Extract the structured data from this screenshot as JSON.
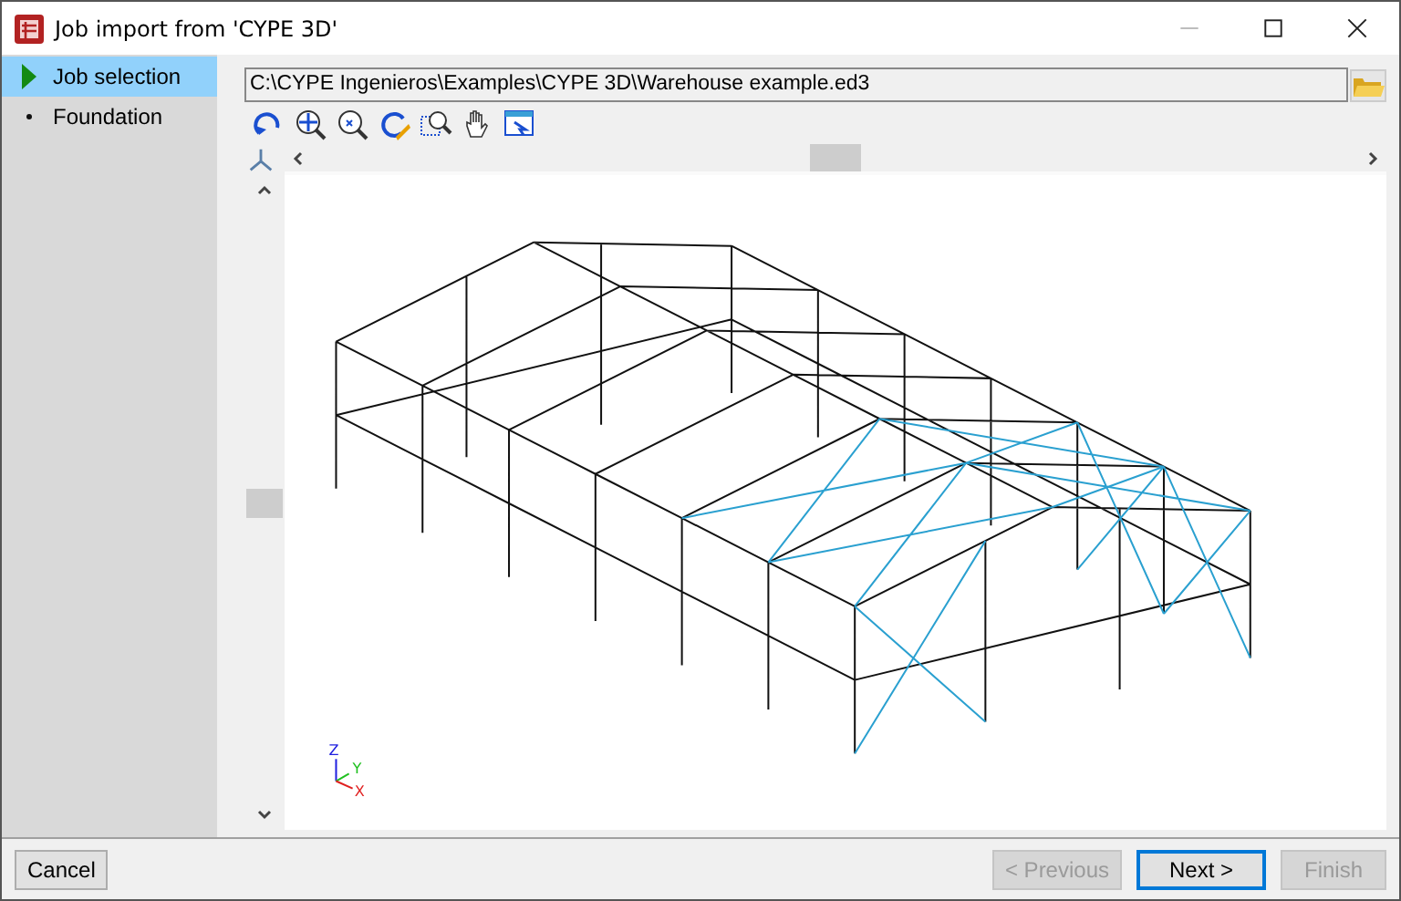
{
  "window": {
    "title": "Job import from 'CYPE 3D'"
  },
  "steps": [
    {
      "label": "Job selection",
      "selected": true
    },
    {
      "label": "Foundation",
      "selected": false
    }
  ],
  "file_path": {
    "value": "C:\\CYPE Ingenieros\\Examples\\CYPE 3D\\Warehouse example.ed3"
  },
  "axes": {
    "x": "X",
    "y": "Y",
    "z": "Z"
  },
  "buttons": [
    {
      "label": "Cancel",
      "disabled": false,
      "default": false
    },
    {
      "label": "< Previous",
      "disabled": true,
      "default": false
    },
    {
      "label": "Next >",
      "disabled": false,
      "default": true
    },
    {
      "label": "Finish",
      "disabled": true,
      "default": false
    }
  ]
}
